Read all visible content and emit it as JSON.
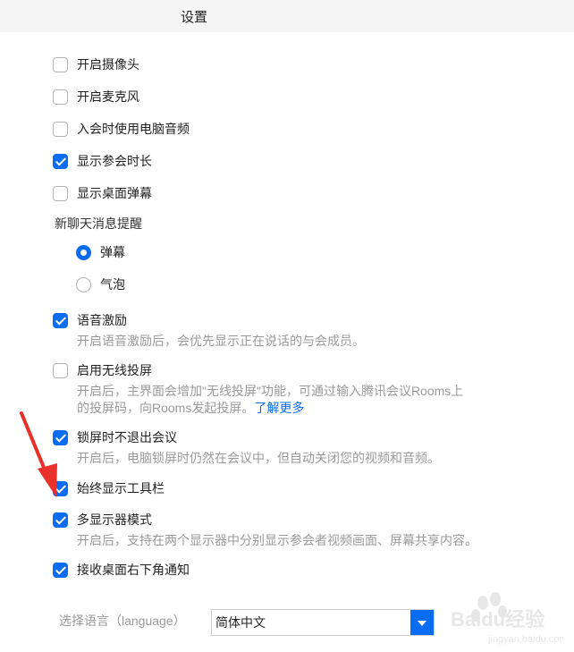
{
  "window": {
    "title": "设置"
  },
  "settings": {
    "camera": {
      "label": "开启摄像头",
      "checked": false
    },
    "mic": {
      "label": "开启麦克风",
      "checked": false
    },
    "computer_audio": {
      "label": "入会时使用电脑音频",
      "checked": false
    },
    "show_duration": {
      "label": "显示参会时长",
      "checked": true
    },
    "show_barrage": {
      "label": "显示桌面弹幕",
      "checked": false
    },
    "chat_reminder": {
      "title": "新聊天消息提醒",
      "options": [
        {
          "label": "弹幕",
          "selected": true
        },
        {
          "label": "气泡",
          "selected": false
        }
      ]
    },
    "voice_incentive": {
      "label": "语音激励",
      "checked": true,
      "desc": "开启语音激励后，会优先显示正在说话的与会成员。"
    },
    "wireless_cast": {
      "label": "启用无线投屏",
      "checked": false,
      "desc_line1": "开启后，主界面会增加\"无线投屏\"功能，可通过输入腾讯会议Rooms上",
      "desc_line2": "的投屏码，向Rooms发起投屏。",
      "link": "了解更多"
    },
    "lock_screen": {
      "label": "锁屏时不退出会议",
      "checked": true,
      "desc": "开启后，电脑锁屏时仍然在会议中，但自动关闭您的视频和音频。"
    },
    "always_toolbar": {
      "label": "始终显示工具栏",
      "checked": true
    },
    "multi_display": {
      "label": "多显示器模式",
      "checked": true,
      "desc": "开启后，支持在两个显示器中分别显示参会者视频画面、屏幕共享内容。"
    },
    "desktop_notify": {
      "label": "接收桌面右下角通知",
      "checked": true
    }
  },
  "language": {
    "label": "选择语言（language）",
    "value": "简体中文"
  },
  "watermark": {
    "brand": "Baidu经验",
    "url": "jingyan.baidu.com"
  },
  "colors": {
    "accent": "#0a6cf0",
    "annotation_arrow": "#e8312a"
  }
}
